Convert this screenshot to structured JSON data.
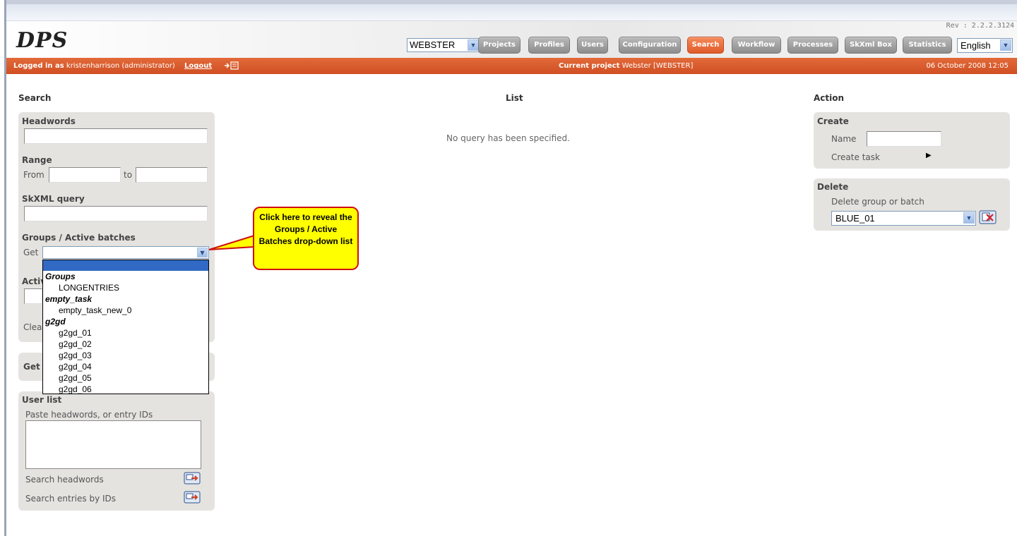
{
  "header": {
    "logo": "DPS",
    "revision": "Rev : 2.2.2.3124",
    "project_select": "WEBSTER",
    "nav": [
      "Projects",
      "Profiles",
      "Users",
      "Configuration",
      "Search",
      "Workflow",
      "Processes",
      "SkXml Box",
      "Statistics"
    ],
    "active_nav": "Search",
    "language": "English"
  },
  "status": {
    "logged_in_label": "Logged in as",
    "user": "kristenharrison (administrator)",
    "logout": "Logout",
    "current_project_label": "Current project",
    "current_project": "Webster [WEBSTER]",
    "datetime": "06 October 2008 12:05"
  },
  "search": {
    "title": "Search",
    "headwords_label": "Headwords",
    "range_label": "Range",
    "from_label": "From",
    "to_label": "to",
    "skxml_label": "SkXML query",
    "groups_label": "Groups / Active batches",
    "get_label": "Get",
    "active_partial": "Activ",
    "clear_partial": "Clea",
    "get_panel_label": "Get",
    "user_list_label": "User list",
    "paste_hint": "Paste headwords, or entry IDs",
    "search_headwords": "Search headwords",
    "search_ids": "Search entries by IDs"
  },
  "dropdown": {
    "options": [
      {
        "group": "Groups",
        "items": [
          "LONGENTRIES"
        ]
      },
      {
        "group": "empty_task",
        "items": [
          "empty_task_new_0"
        ]
      },
      {
        "group": "g2gd",
        "items": [
          "g2gd_01",
          "g2gd_02",
          "g2gd_03",
          "g2gd_04",
          "g2gd_05",
          "g2gd_06"
        ]
      }
    ]
  },
  "callout": {
    "text": "Click here to reveal the Groups / Active Batches drop-down list"
  },
  "list": {
    "title": "List",
    "empty_message": "No query has been specified."
  },
  "action": {
    "title": "Action",
    "create_label": "Create",
    "name_label": "Name",
    "create_task": "Create task",
    "delete_label": "Delete",
    "delete_hint": "Delete group or batch",
    "delete_select": "BLUE_01"
  },
  "colors": {
    "accent_orange": "#d9582a",
    "panel_gray": "#e4e3e0",
    "callout_yellow": "#ffff00",
    "callout_border": "#d01010",
    "selection_blue": "#316ac5"
  }
}
